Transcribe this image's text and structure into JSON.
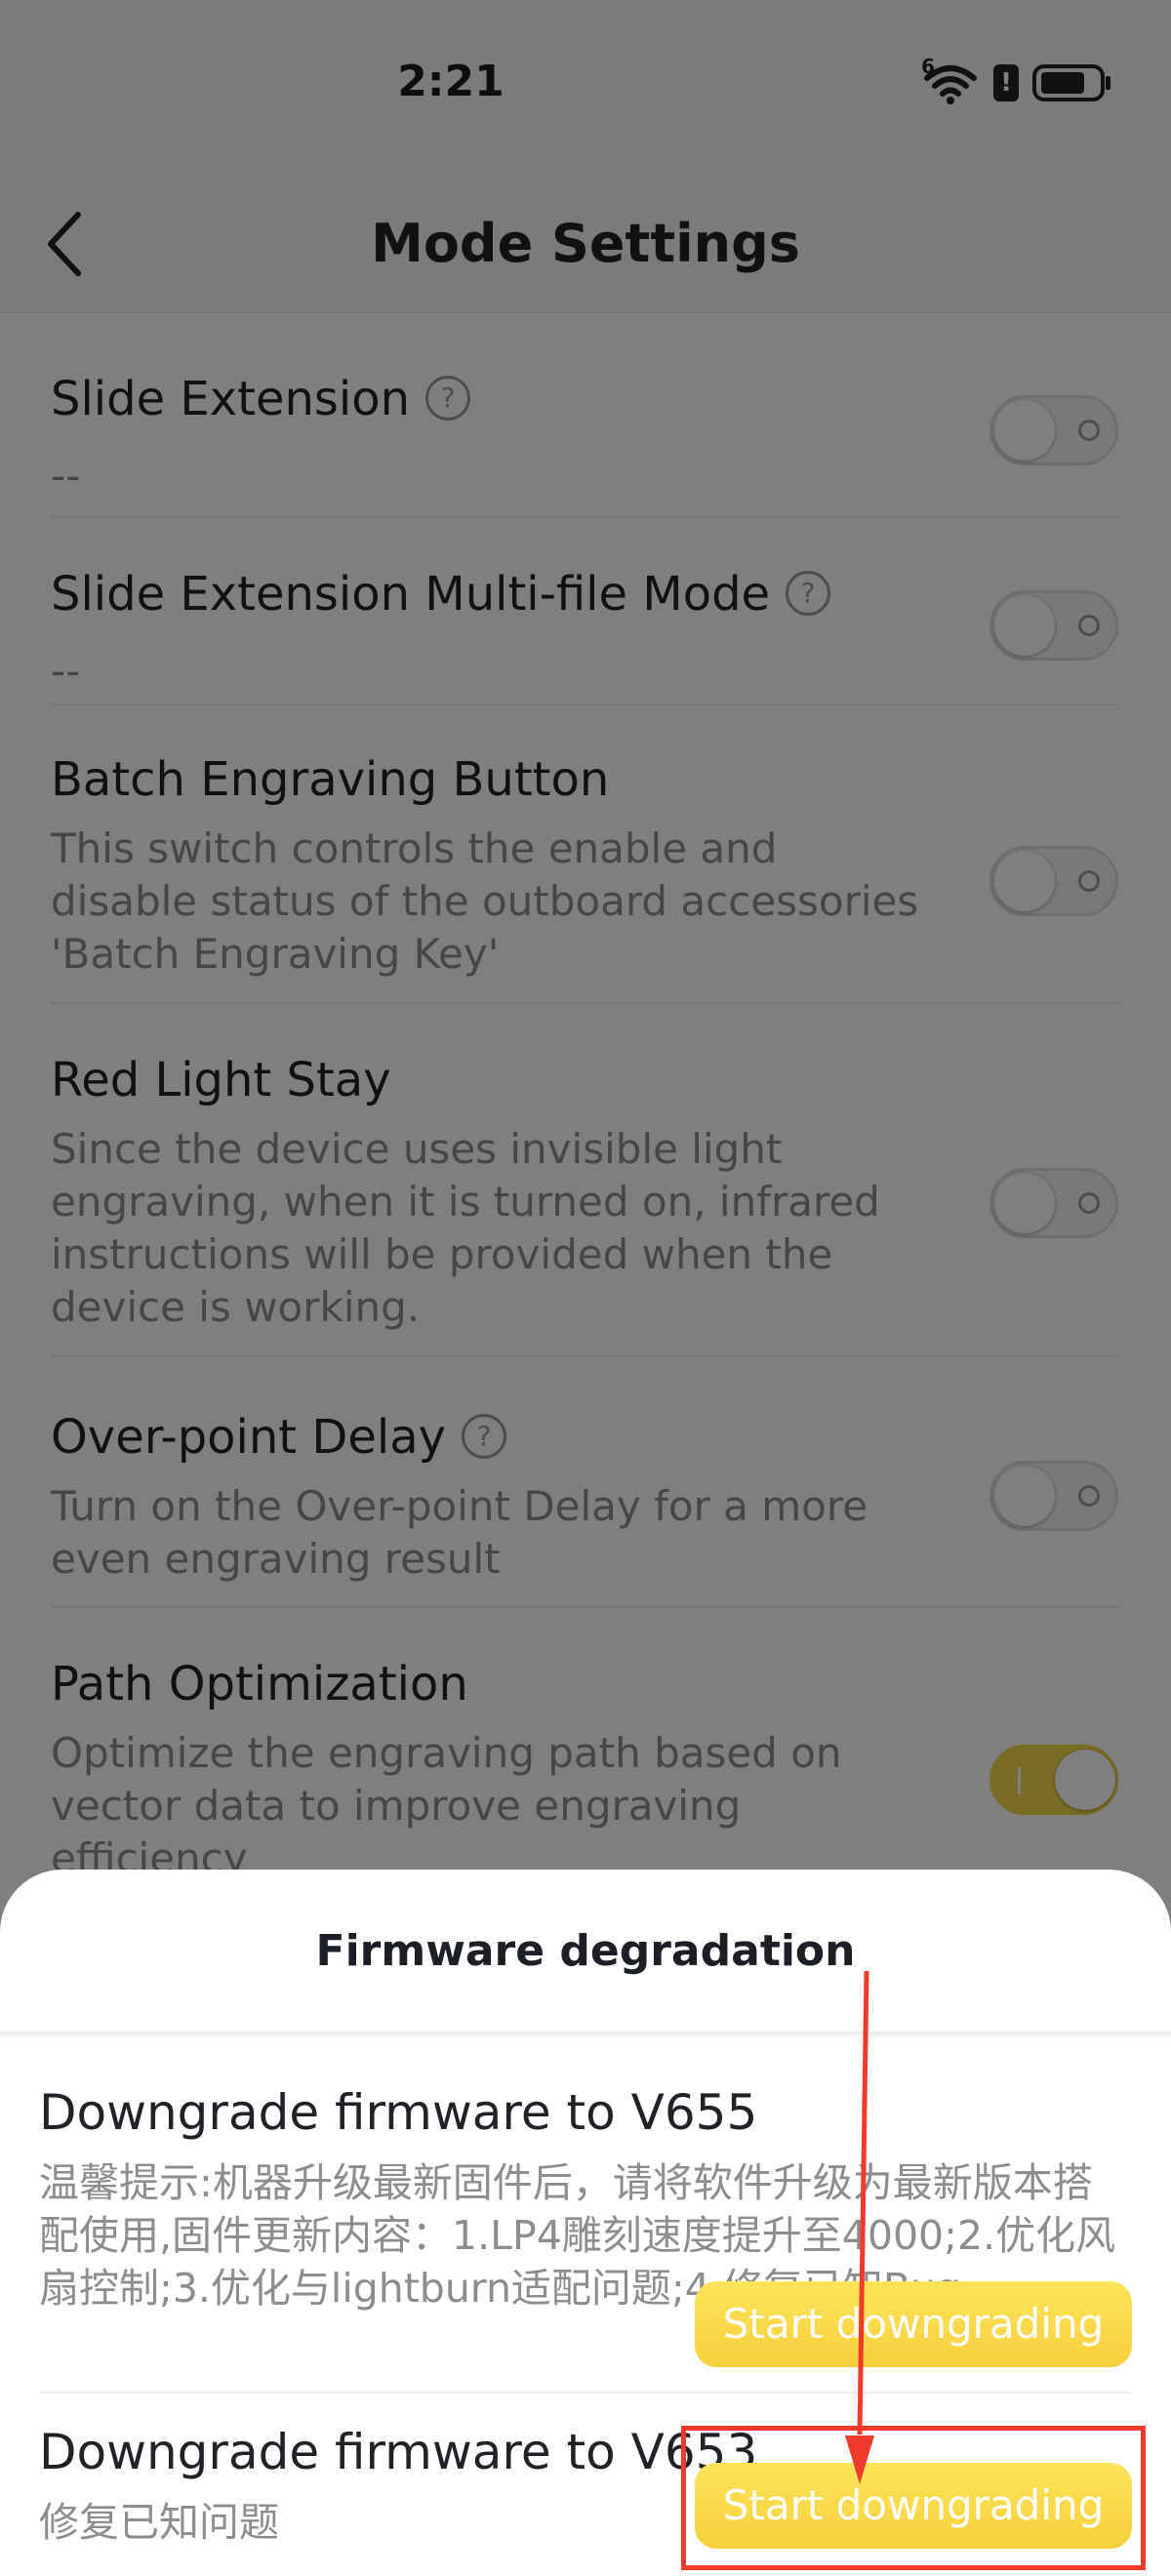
{
  "status_bar": {
    "time": "2:21",
    "network": "6"
  },
  "header": {
    "title": "Mode Settings"
  },
  "settings": [
    {
      "title": "Slide Extension",
      "desc": "--",
      "help": "?",
      "on": false
    },
    {
      "title": "Slide Extension Multi-file Mode",
      "desc": "--",
      "help": "?",
      "on": false
    },
    {
      "title": "Batch Engraving Button",
      "desc": "This switch controls the enable and disable status of the outboard accessories 'Batch Engraving Key'",
      "on": false
    },
    {
      "title": "Red Light Stay",
      "desc": "Since the device uses invisible light engraving, when it is turned on, infrared instructions will be provided when the device is working.",
      "on": false
    },
    {
      "title": "Over-point Delay",
      "desc": "Turn on the Over-point Delay for a more even engraving result",
      "help": "?",
      "on": false
    },
    {
      "title": "Path Optimization",
      "desc": "Optimize the engraving path based on vector data to improve engraving efficiency",
      "on": true
    }
  ],
  "sheet": {
    "title": "Firmware degradation",
    "items": [
      {
        "title": "Downgrade firmware to V655",
        "note": "温馨提示:机器升级最新固件后，请将软件升级为最新版本搭配使用,固件更新内容：1.LP4雕刻速度提升至4000;2.优化风扇控制;3.优化与lightburn适配问题;4.修复已知Bug",
        "button": "Start downgrading"
      },
      {
        "title": "Downgrade firmware to V653",
        "note": "修复已知问题",
        "button": "Start downgrading"
      }
    ]
  },
  "colors": {
    "accent": "#f6d03f",
    "annotation": "#ef3a2c"
  }
}
